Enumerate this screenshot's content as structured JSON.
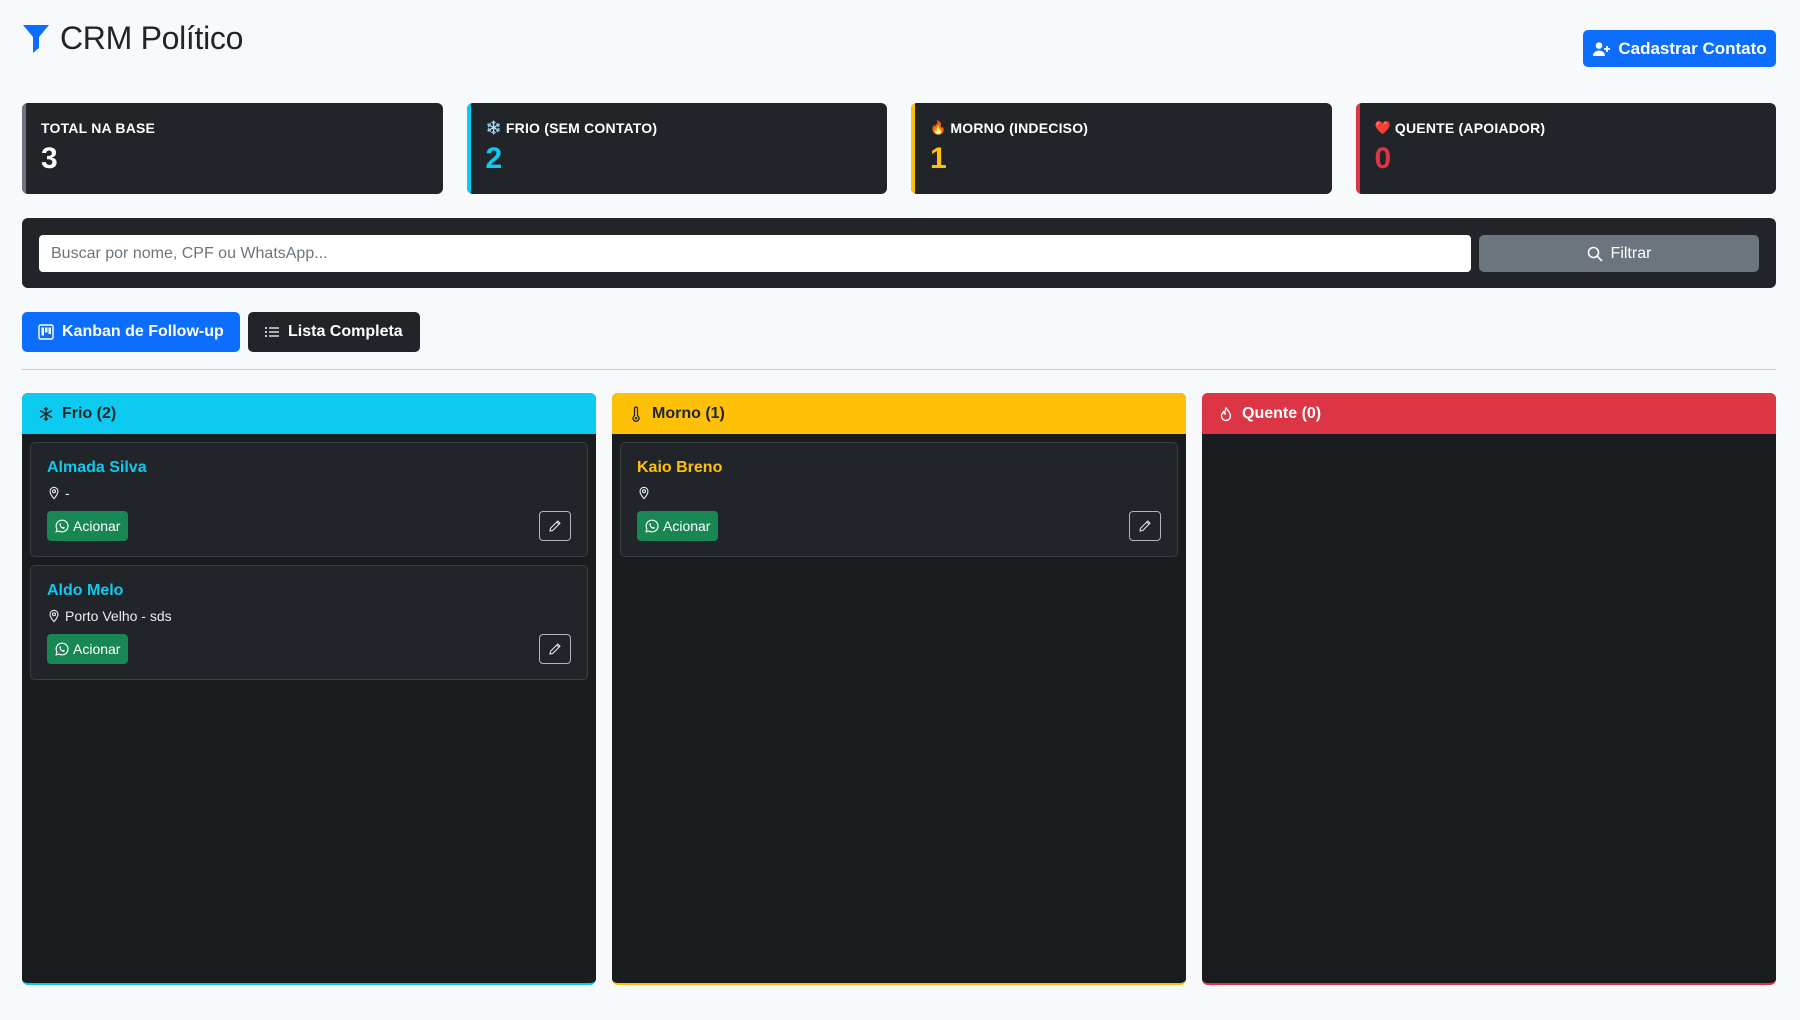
{
  "header": {
    "title": "CRM Político",
    "new_contact_label": "Cadastrar Contato"
  },
  "stats": [
    {
      "label": "TOTAL NA BASE",
      "emoji": "",
      "value": "3"
    },
    {
      "label": "FRIO (SEM CONTATO)",
      "emoji": "❄️",
      "value": "2"
    },
    {
      "label": "MORNO (INDECISO)",
      "emoji": "🔥",
      "value": "1"
    },
    {
      "label": "QUENTE (APOIADOR)",
      "emoji": "❤️",
      "value": "0"
    }
  ],
  "search": {
    "placeholder": "Buscar por nome, CPF ou WhatsApp...",
    "value": "",
    "filter_label": "Filtrar"
  },
  "views": {
    "kanban_label": "Kanban de Follow-up",
    "list_label": "Lista Completa"
  },
  "columns": [
    {
      "title": "Frio (2)",
      "cards": [
        {
          "name": "Almada Silva",
          "location": "-",
          "action_label": "Acionar"
        },
        {
          "name": "Aldo Melo",
          "location": "Porto Velho - sds",
          "action_label": "Acionar"
        }
      ]
    },
    {
      "title": "Morno (1)",
      "cards": [
        {
          "name": "Kaio Breno",
          "location": "",
          "action_label": "Acionar"
        }
      ]
    },
    {
      "title": "Quente (0)",
      "cards": []
    }
  ],
  "colors": {
    "primary": "#0d6efd",
    "frio": "#0dcaf0",
    "morno": "#ffc107",
    "quente": "#dc3545",
    "whatsapp": "#198754",
    "dark": "#212529"
  }
}
